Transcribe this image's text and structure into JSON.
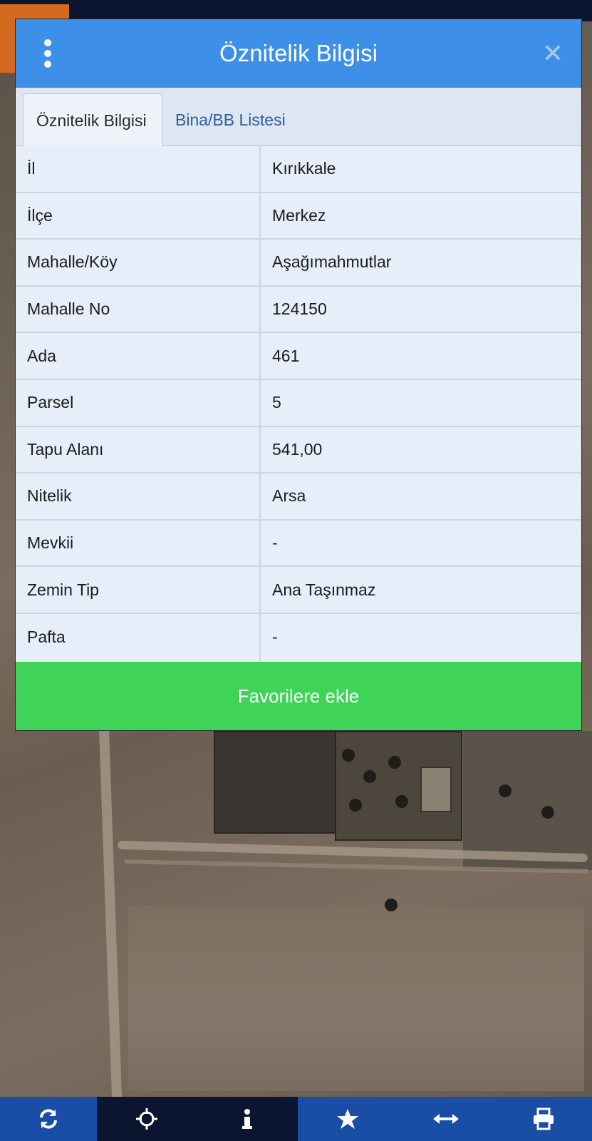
{
  "dialog": {
    "title": "Öznitelik Bilgisi",
    "tabs": [
      {
        "label": "Öznitelik Bilgisi",
        "active": true
      },
      {
        "label": "Bina/BB Listesi",
        "active": false
      }
    ],
    "rows": [
      {
        "key": "İl",
        "value": "Kırıkkale"
      },
      {
        "key": "İlçe",
        "value": "Merkez"
      },
      {
        "key": "Mahalle/Köy",
        "value": "Aşağımahmutlar"
      },
      {
        "key": "Mahalle No",
        "value": "124150"
      },
      {
        "key": "Ada",
        "value": "461"
      },
      {
        "key": "Parsel",
        "value": "5"
      },
      {
        "key": "Tapu Alanı",
        "value": "541,00"
      },
      {
        "key": "Nitelik",
        "value": "Arsa"
      },
      {
        "key": "Mevkii",
        "value": "-"
      },
      {
        "key": "Zemin Tip",
        "value": "Ana Taşınmaz"
      },
      {
        "key": "Pafta",
        "value": "-"
      }
    ],
    "favorite_button": "Favorilere ekle",
    "icons": {
      "menu": "kebab-menu-icon",
      "close": "close-icon"
    }
  },
  "toolbar": {
    "buttons": [
      {
        "name": "refresh-icon"
      },
      {
        "name": "locate-icon"
      },
      {
        "name": "info-icon"
      },
      {
        "name": "star-icon"
      },
      {
        "name": "measure-icon"
      },
      {
        "name": "print-icon"
      }
    ]
  },
  "colors": {
    "header": "#3d8fe8",
    "favorite_button": "#3fd357",
    "toolbar_blue": "#1a4ea6",
    "toolbar_dark": "#0b1530"
  }
}
